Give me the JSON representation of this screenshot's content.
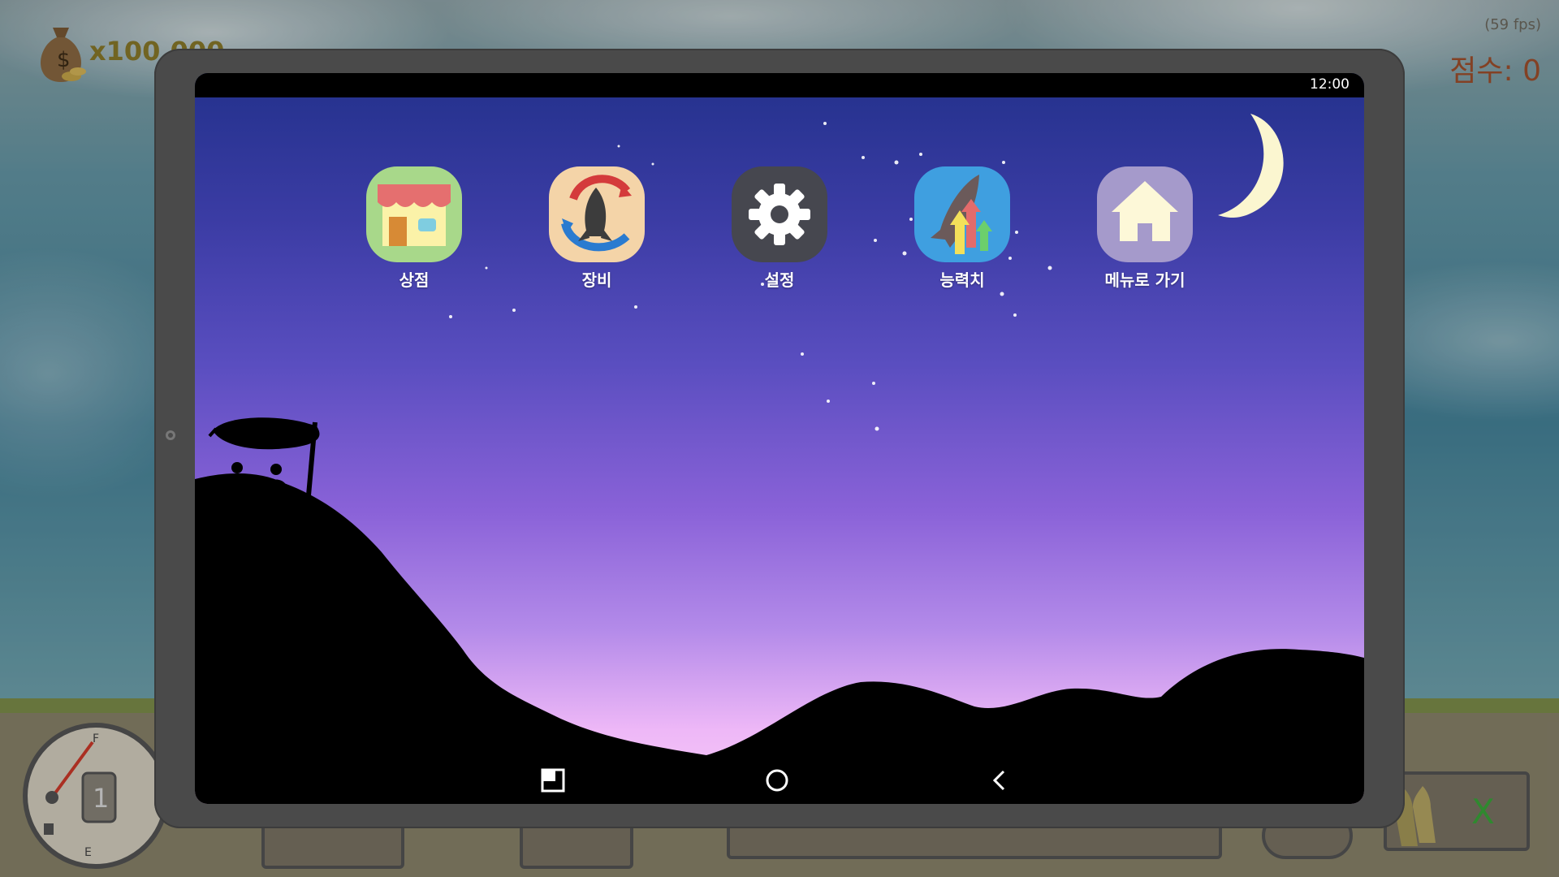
{
  "hud": {
    "money": "x100,000",
    "fps": "(59 fps)",
    "score": "점수: 0",
    "gear_number": "1",
    "fuel_full_label": "F",
    "fuel_empty_label": "E",
    "ammo_label": "X"
  },
  "tablet": {
    "clock": "12:00",
    "apps": [
      {
        "label": "상점",
        "icon": "shop-icon"
      },
      {
        "label": "장비",
        "icon": "rocket-equipment-icon"
      },
      {
        "label": "설정",
        "icon": "gear-icon"
      },
      {
        "label": "능력치",
        "icon": "stats-upgrade-icon"
      },
      {
        "label": "메뉴로 가기",
        "icon": "home-icon"
      }
    ],
    "nav": [
      "recents-icon",
      "home-circle-icon",
      "back-icon"
    ]
  },
  "colors": {
    "sky_top": "#23318c",
    "sky_bottom": "#f6c8f8",
    "shop_bg": "#a8d88a",
    "equipment_bg": "#f4d4a8",
    "settings_bg": "#46474f",
    "stats_bg": "#3f9fe0",
    "home_bg": "#a59acb"
  }
}
